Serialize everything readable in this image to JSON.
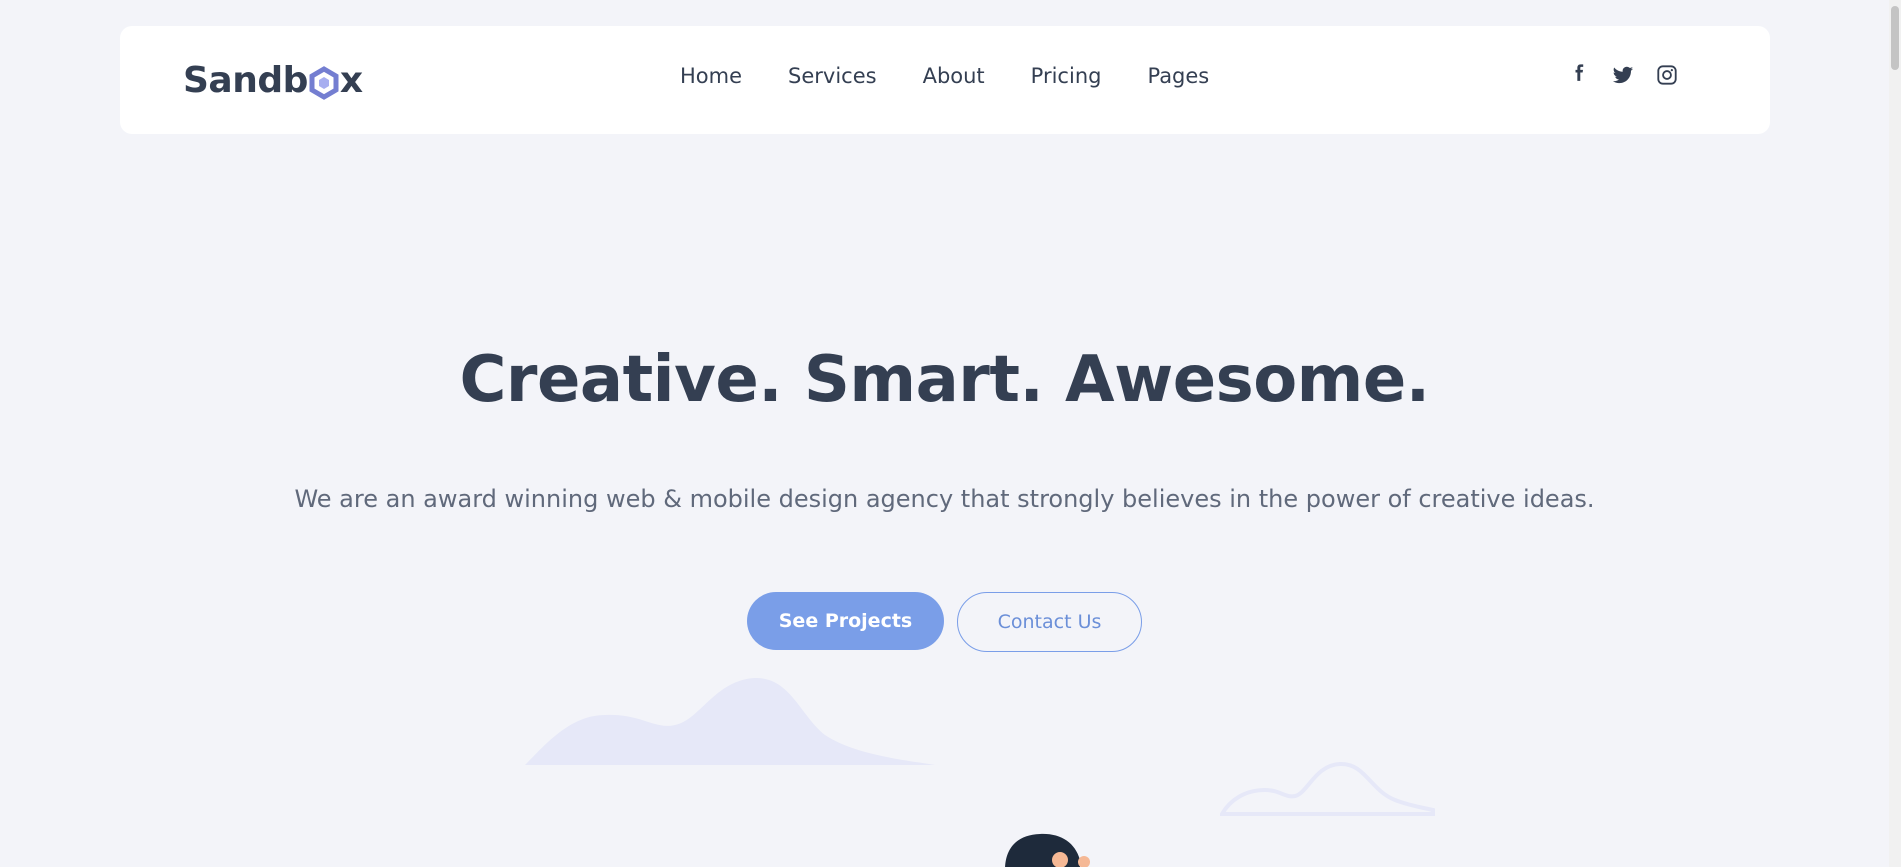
{
  "brand": {
    "name_start": "Sandb",
    "name_end": "x",
    "accent_color": "#747ed1"
  },
  "nav": {
    "links": [
      {
        "label": "Home"
      },
      {
        "label": "Services"
      },
      {
        "label": "About"
      },
      {
        "label": "Pricing"
      },
      {
        "label": "Pages"
      }
    ]
  },
  "socials": [
    {
      "icon": "facebook-icon"
    },
    {
      "icon": "twitter-icon"
    },
    {
      "icon": "instagram-icon"
    }
  ],
  "hero": {
    "title": "Creative. Smart. Awesome.",
    "subtitle": "We are an award winning web & mobile design agency that strongly believes in the power of creative ideas.",
    "primary_button": "See Projects",
    "secondary_button": "Contact Us"
  },
  "colors": {
    "background": "#f3f4f9",
    "text_dark": "#343f52",
    "text_muted": "#60697b",
    "primary": "#7a9ee8"
  }
}
